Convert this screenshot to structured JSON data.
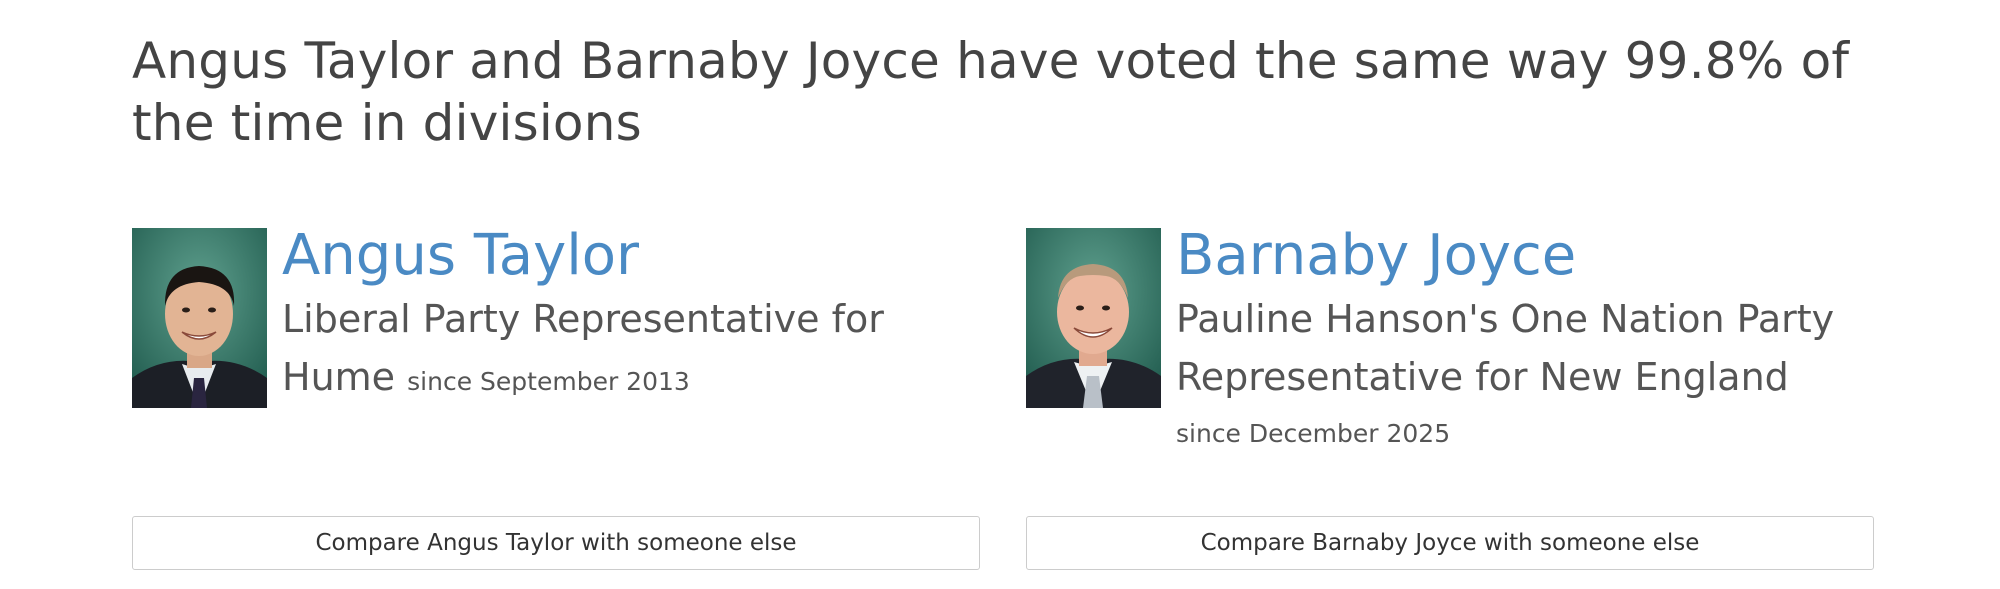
{
  "headline": "Angus Taylor and Barnaby Joyce have voted the same way 99.8% of the time in divisions",
  "members": [
    {
      "name": "Angus Taylor",
      "role": "Liberal Party Representative for Hume",
      "since": "since September 2013",
      "photo_icon": "person-portrait-icon",
      "compare_label": "Compare Angus Taylor with someone else"
    },
    {
      "name": "Barnaby Joyce",
      "role": "Pauline Hanson's One Nation Party Representative for New England",
      "since": "since December 2025",
      "photo_icon": "person-portrait-icon",
      "compare_label": "Compare Barnaby Joyce with someone else"
    }
  ],
  "colors": {
    "name_link": "#4a8ac4",
    "text": "#444444",
    "button_border": "#cccccc"
  }
}
